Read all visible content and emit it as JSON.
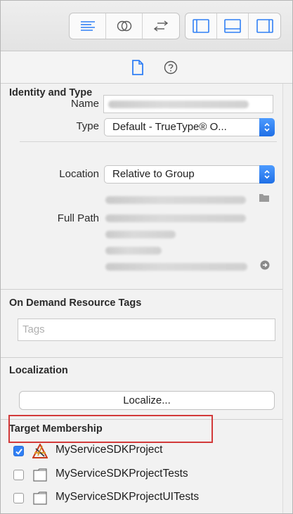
{
  "toolbar": {
    "left_group": [
      "editor-standard-icon",
      "editor-assistant-icon",
      "editor-version-icon"
    ],
    "right_group": [
      "navigator-panel-icon",
      "debug-area-icon",
      "utilities-panel-icon"
    ],
    "active_color": "#2f7ff5"
  },
  "inspector_tabs": [
    "file-inspector-icon",
    "quick-help-icon"
  ],
  "identity": {
    "header": "Identity and Type",
    "name_label": "Name",
    "type_label": "Type",
    "type_value": "Default - TrueType® O...",
    "location_label": "Location",
    "location_value": "Relative to Group",
    "full_path_label": "Full Path"
  },
  "on_demand": {
    "header": "On Demand Resource Tags",
    "tags_placeholder": "Tags"
  },
  "localization": {
    "header": "Localization",
    "localize_button": "Localize..."
  },
  "target_membership": {
    "header": "Target Membership",
    "targets": [
      {
        "name": "MyServiceSDKProject",
        "checked": true,
        "icon": "app-target-icon"
      },
      {
        "name": "MyServiceSDKProjectTests",
        "checked": false,
        "icon": "folder-target-icon"
      },
      {
        "name": "MyServiceSDKProjectUITests",
        "checked": false,
        "icon": "folder-target-icon"
      }
    ],
    "highlight_color": "#d23a3a"
  }
}
